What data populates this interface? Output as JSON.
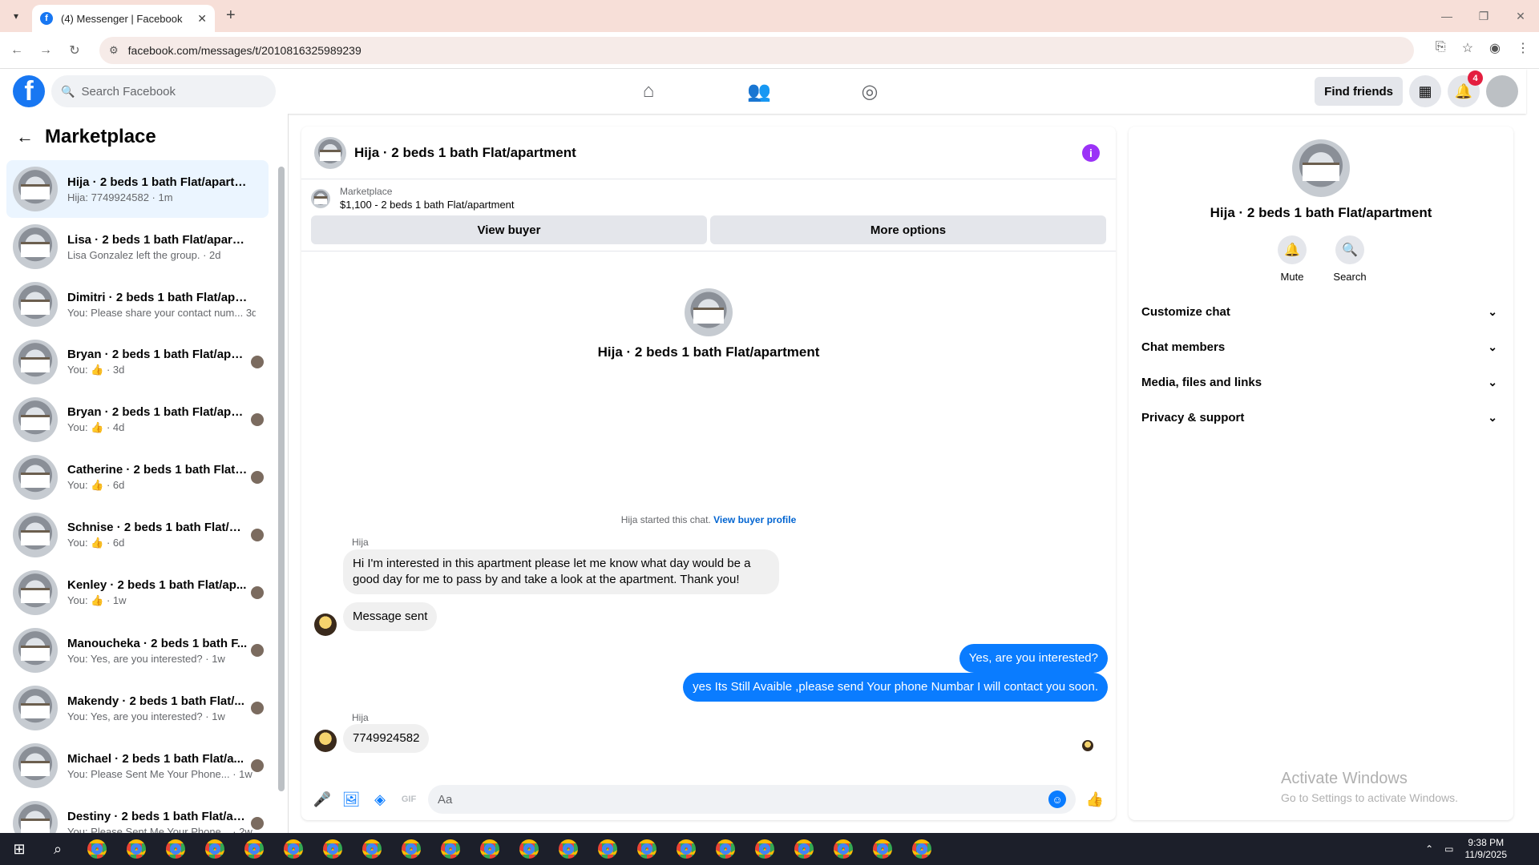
{
  "browser": {
    "tab_title": "(4) Messenger | Facebook",
    "url": "facebook.com/messages/t/2010816325989239"
  },
  "header": {
    "search_placeholder": "Search Facebook",
    "find_friends": "Find friends",
    "notification_count": "4",
    "brand_color": "#1877f2"
  },
  "sidebar": {
    "title": "Marketplace",
    "conversations": [
      {
        "name": "Hija · 2 beds 1 bath Flat/apartm...",
        "snippet": "Hija: 7749924582 · 1m"
      },
      {
        "name": "Lisa · 2 beds 1 bath Flat/apartme...",
        "snippet": "Lisa Gonzalez left the group. · 2d"
      },
      {
        "name": "Dimitri · 2 beds 1 bath Flat/apart...",
        "snippet": "You: Please share your contact num... 3d"
      },
      {
        "name": "Bryan · 2 beds 1 bath Flat/apa...",
        "snippet": "You: 👍 · 3d"
      },
      {
        "name": "Bryan · 2 beds 1 bath Flat/apart...",
        "snippet": "You: 👍 · 4d"
      },
      {
        "name": "Catherine · 2 beds 1 bath Flat/...",
        "snippet": "You: 👍 · 6d"
      },
      {
        "name": "Schnise · 2 beds 1 bath Flat/ap...",
        "snippet": "You: 👍 · 6d"
      },
      {
        "name": "Kenley · 2 beds 1 bath Flat/ap...",
        "snippet": "You: 👍 · 1w"
      },
      {
        "name": "Manoucheka · 2 beds 1 bath F...",
        "snippet": "You: Yes, are you interested? · 1w"
      },
      {
        "name": "Makendy · 2 beds 1 bath Flat/...",
        "snippet": "You: Yes, are you interested? · 1w"
      },
      {
        "name": "Michael · 2 beds 1 bath Flat/a...",
        "snippet": "You: Please Sent Me Your Phone... · 1w"
      },
      {
        "name": "Destiny · 2 beds 1 bath Flat/ap...",
        "snippet": "You: Please Sent Me Your Phone... · 2w"
      }
    ]
  },
  "chat": {
    "title": "Hija · 2 beds 1 bath Flat/apartment",
    "marketplace_label": "Marketplace",
    "listing": "$1,100 - 2 beds 1 bath Flat/apartment",
    "view_buyer": "View buyer",
    "more_options": "More options",
    "intro_title": "Hija · 2 beds 1 bath Flat/apartment",
    "started_text": "Hija started this chat.",
    "view_buyer_profile": "View buyer profile",
    "sender1": "Hija",
    "msg1": "Hi I'm interested in this apartment please let me know what day would be a good day for me to pass by and take a look at the apartment. Thank you!",
    "msg2": "Message sent",
    "out1": "Yes, are you interested?",
    "out2": "yes Its Still Avaible ,please send Your phone Numbar I will contact you soon.",
    "sender2": "Hija",
    "msg3": "7749924582",
    "composer_placeholder": "Aa",
    "accent_color": "#0a7cff"
  },
  "right_panel": {
    "name": "Hija · 2 beds 1 bath Flat/apartment",
    "mute": "Mute",
    "search": "Search",
    "sections": [
      "Customize chat",
      "Chat members",
      "Media, files and links",
      "Privacy & support"
    ],
    "activate_title": "Activate Windows",
    "activate_sub": "Go to Settings to activate Windows."
  },
  "taskbar": {
    "time": "9:38 PM",
    "date": "11/9/2025"
  }
}
